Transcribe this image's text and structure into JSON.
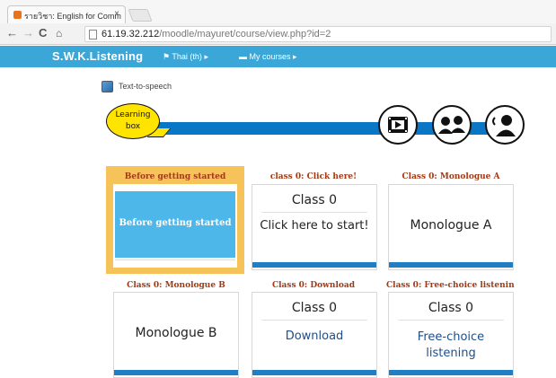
{
  "browser": {
    "tab_title": "รายวิชา: English for Comm",
    "tab_close": "×",
    "url_host": "61.19.32.212",
    "url_path": "/moodle/mayuret/course/view.php?id=2"
  },
  "navbar": {
    "brand": "S.W.K.Listening",
    "language": "Thai (th)",
    "courses": "My courses"
  },
  "tts": {
    "label": "Text-to-speech"
  },
  "banner": {
    "bubble_line1": "Learning",
    "bubble_line2": "box"
  },
  "cards": [
    {
      "title": "Before getting started",
      "main": "Before getting started"
    },
    {
      "title": "class 0: Click here!",
      "class_label": "Class 0",
      "main": "Click here to start!"
    },
    {
      "title": "Class 0: Monologue A",
      "main": "Monologue A"
    },
    {
      "title": "Class 0: Monologue B",
      "main": "Monologue B"
    },
    {
      "title": "Class 0: Download",
      "class_label": "Class 0",
      "main": "Download"
    },
    {
      "title": "Class 0: Free-choice listenin",
      "class_label": "Class 0",
      "main_line1": "Free-choice",
      "main_line2": "listening"
    }
  ],
  "colors": {
    "navbar": "#3aa7d8",
    "accent_title": "#a33a14",
    "highlight": "#f6c25a",
    "stripe": "#1f7ec4"
  }
}
